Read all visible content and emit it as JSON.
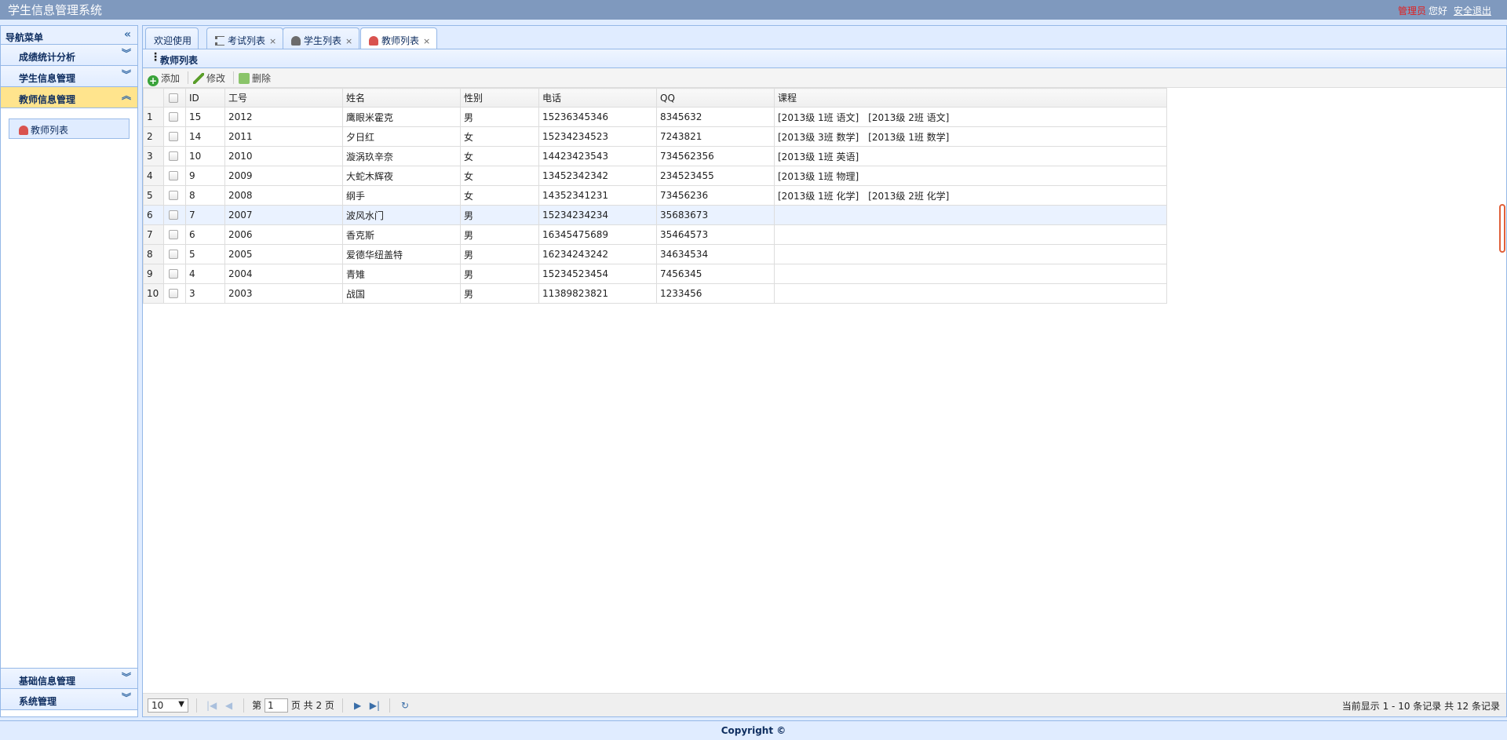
{
  "app": {
    "title": "学生信息管理系统"
  },
  "header": {
    "user_role": "管理员",
    "greeting": "您好",
    "logout_label": "安全退出"
  },
  "nav": {
    "title": "导航菜单",
    "sections": [
      {
        "label": "成绩统计分析"
      },
      {
        "label": "学生信息管理"
      },
      {
        "label": "教师信息管理"
      }
    ],
    "active_item": "教师列表",
    "bottom_sections": [
      {
        "label": "基础信息管理"
      },
      {
        "label": "系统管理"
      }
    ]
  },
  "tabs": [
    {
      "label": "欢迎使用"
    },
    {
      "label": "考试列表"
    },
    {
      "label": "学生列表"
    },
    {
      "label": "教师列表"
    }
  ],
  "panel": {
    "title": "教师列表"
  },
  "toolbar": {
    "add": "添加",
    "edit": "修改",
    "delete": "删除"
  },
  "grid": {
    "columns": [
      "ID",
      "工号",
      "姓名",
      "性别",
      "电话",
      "QQ",
      "课程"
    ],
    "rows": [
      {
        "n": "1",
        "id": "15",
        "no": "2012",
        "name": "鹰眼米霍克",
        "sex": "男",
        "phone": "15236345346",
        "qq": "8345632",
        "course": "[2013级 1班 语文]　[2013级 2班 语文]"
      },
      {
        "n": "2",
        "id": "14",
        "no": "2011",
        "name": "夕日红",
        "sex": "女",
        "phone": "15234234523",
        "qq": "7243821",
        "course": "[2013级 3班 数学]　[2013级 1班 数学]"
      },
      {
        "n": "3",
        "id": "10",
        "no": "2010",
        "name": "漩涡玖辛奈",
        "sex": "女",
        "phone": "14423423543",
        "qq": "734562356",
        "course": "[2013级 1班 英语]"
      },
      {
        "n": "4",
        "id": "9",
        "no": "2009",
        "name": "大蛇木辉夜",
        "sex": "女",
        "phone": "13452342342",
        "qq": "234523455",
        "course": "[2013级 1班 物理]"
      },
      {
        "n": "5",
        "id": "8",
        "no": "2008",
        "name": "纲手",
        "sex": "女",
        "phone": "14352341231",
        "qq": "73456236",
        "course": "[2013级 1班 化学]　[2013级 2班 化学]"
      },
      {
        "n": "6",
        "id": "7",
        "no": "2007",
        "name": "波风水门",
        "sex": "男",
        "phone": "15234234234",
        "qq": "35683673",
        "course": ""
      },
      {
        "n": "7",
        "id": "6",
        "no": "2006",
        "name": "香克斯",
        "sex": "男",
        "phone": "16345475689",
        "qq": "35464573",
        "course": ""
      },
      {
        "n": "8",
        "id": "5",
        "no": "2005",
        "name": "爱德华纽盖特",
        "sex": "男",
        "phone": "16234243242",
        "qq": "34634534",
        "course": ""
      },
      {
        "n": "9",
        "id": "4",
        "no": "2004",
        "name": "青雉",
        "sex": "男",
        "phone": "15234523454",
        "qq": "7456345",
        "course": ""
      },
      {
        "n": "10",
        "id": "3",
        "no": "2003",
        "name": "战国",
        "sex": "男",
        "phone": "11389823821",
        "qq": "1233456",
        "course": ""
      }
    ]
  },
  "pager": {
    "page_size": "10",
    "page_prefix": "第",
    "page_value": "1",
    "page_suffix": "页 共 2 页",
    "info": "当前显示 1 - 10 条记录 共 12 条记录"
  },
  "footer": {
    "text": "Copyright ©"
  }
}
